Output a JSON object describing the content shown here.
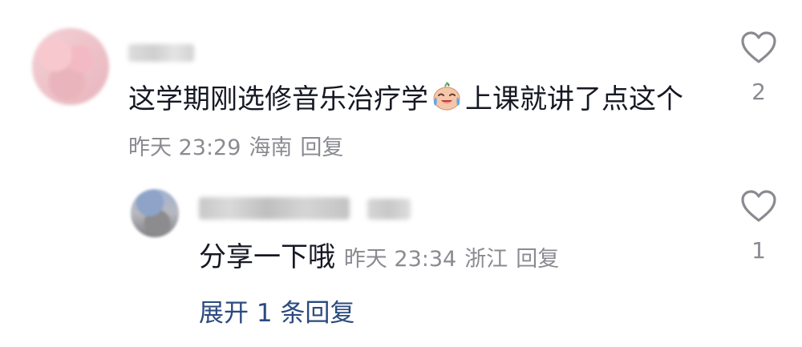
{
  "comment": {
    "text_part1": "这学期刚选修音乐治疗学",
    "text_part2": "上课就讲了点这个",
    "time": "昨天 23:29",
    "location": "海南",
    "reply_label": "回复",
    "like_count": "2",
    "emoji": "crying-laughing-face-icon"
  },
  "reply": {
    "text": "分享一下哦",
    "time": "昨天 23:34",
    "location": "浙江",
    "reply_label": "回复",
    "like_count": "1"
  },
  "expand": {
    "label": "展开 1 条回复"
  },
  "colors": {
    "text": "#161823",
    "meta": "#8a8b91",
    "link": "#2b4a7e"
  }
}
